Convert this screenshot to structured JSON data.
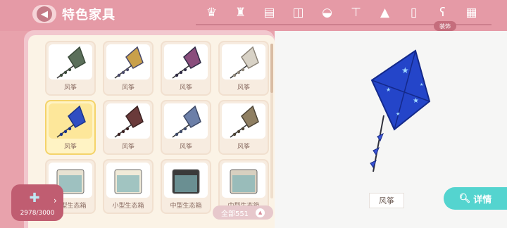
{
  "header": {
    "back_icon": "chevron-left-icon",
    "title": "特色家具",
    "tabs": [
      {
        "icon": "armchair-icon",
        "glyph": "♛"
      },
      {
        "icon": "sofa-icon",
        "glyph": "♜"
      },
      {
        "icon": "bed-icon",
        "glyph": "▤"
      },
      {
        "icon": "oven-icon",
        "glyph": "◫"
      },
      {
        "icon": "bathtub-icon",
        "glyph": "◒"
      },
      {
        "icon": "table-icon",
        "glyph": "⊤"
      },
      {
        "icon": "lamp-icon",
        "glyph": "▲"
      },
      {
        "icon": "fridge-icon",
        "glyph": "▯"
      },
      {
        "icon": "teddy-bear-icon",
        "glyph": "ʕ"
      },
      {
        "icon": "wall-brick-icon",
        "glyph": "▦"
      }
    ],
    "active_tab_label": "装饰"
  },
  "grid": {
    "items": [
      {
        "label": "风筝",
        "kite": [
          "#5b6f5a",
          "#3b4b3a"
        ]
      },
      {
        "label": "风筝",
        "kite": [
          "#c9a04a",
          "#4a4a6a"
        ]
      },
      {
        "label": "风筝",
        "kite": [
          "#8a4d7c",
          "#2f2a44"
        ]
      },
      {
        "label": "风筝",
        "kite": [
          "#d8d2c6",
          "#8c8478"
        ]
      },
      {
        "label": "风筝",
        "kite": [
          "#2f4ec2",
          "#19338a"
        ],
        "selected": true
      },
      {
        "label": "风筝",
        "kite": [
          "#6a3a3a",
          "#3a2020"
        ]
      },
      {
        "label": "风筝",
        "kite": [
          "#6c7fa8",
          "#3e4a68"
        ]
      },
      {
        "label": "风筝",
        "kite": [
          "#8f7f62",
          "#4e4536"
        ]
      },
      {
        "label": "小型生态箱",
        "box": "#e8e2d2"
      },
      {
        "label": "小型生态箱",
        "box": "#f0ead8"
      },
      {
        "label": "中型生态箱",
        "box": "#3a3a3a"
      },
      {
        "label": "中型生态箱",
        "box": "#d8d0c0"
      }
    ],
    "total_count": "全部551"
  },
  "capacity": {
    "icon": "puzzle-pieces-icon",
    "text": "2978/3000"
  },
  "preview": {
    "name": "风筝",
    "detail_label": "详情",
    "colors": {
      "kite_main": "#2445c9",
      "kite_dark": "#14298a",
      "star": "#9fd8ff"
    }
  }
}
